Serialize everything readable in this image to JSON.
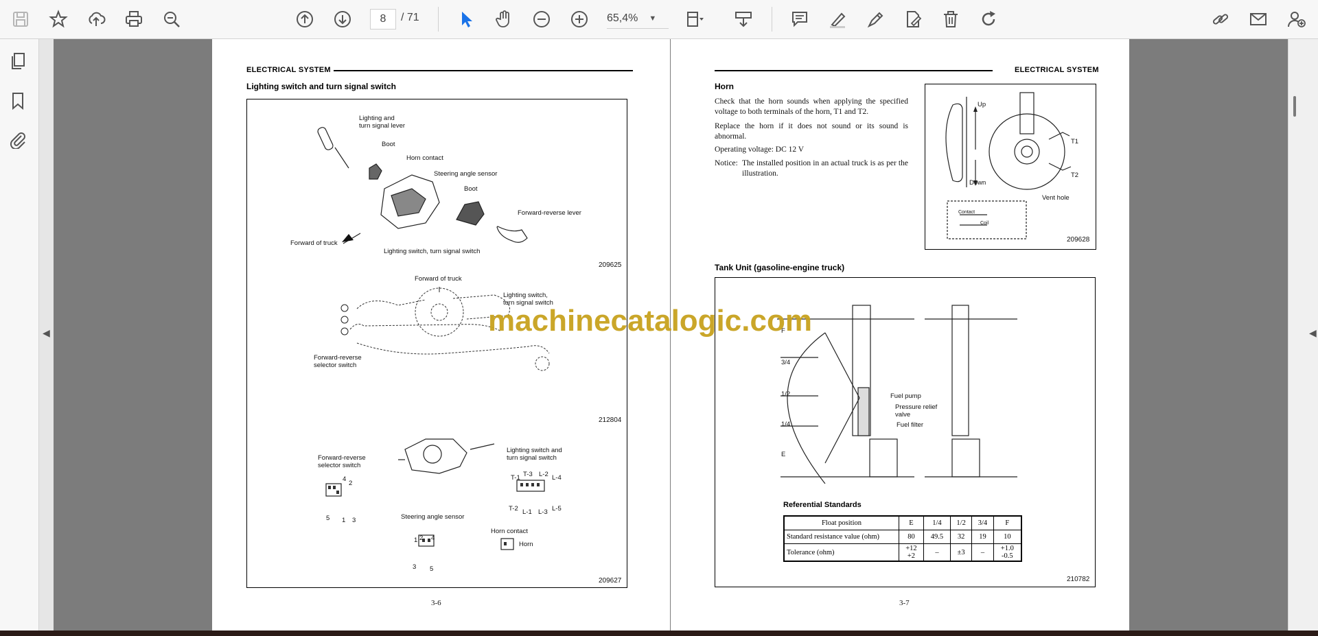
{
  "toolbar": {
    "current_page": "8",
    "total_pages": "/ 71",
    "zoom": "65,4%"
  },
  "left_page": {
    "header": "ELECTRICAL SYSTEM",
    "section_title": "Lighting switch and turn signal switch",
    "fig1": {
      "labels": [
        "Lighting and\nturn signal lever",
        "Boot",
        "Horn contact",
        "Steering angle sensor",
        "Boot",
        "Forward-reverse lever",
        "Forward of truck",
        "Lighting switch, turn signal switch"
      ],
      "code": "209625"
    },
    "fig2": {
      "labels": [
        "Forward of truck",
        "Lighting switch,\nturn signal switch",
        "Forward-reverse\nselector switch"
      ],
      "code": "212804"
    },
    "fig3": {
      "labels": [
        "Forward-reverse\nselector switch",
        "Lighting switch and\nturn signal switch",
        "Steering angle sensor",
        "Horn contact",
        "Horn"
      ],
      "pins": [
        "T-1",
        "T-3",
        "L-2",
        "L-4",
        "T-2",
        "L-1",
        "L-3",
        "L-5",
        "4",
        "2",
        "5",
        "1",
        "3",
        "1",
        "2",
        "4",
        "3",
        "5"
      ],
      "code": "209627"
    },
    "page_number": "3-6"
  },
  "right_page": {
    "header": "ELECTRICAL SYSTEM",
    "horn_title": "Horn",
    "horn_text": [
      "Check that the horn sounds when applying the specified voltage to both terminals of the horn, T1 and T2.",
      "Replace the horn if it does not sound or its sound is abnormal.",
      "Operating voltage:  DC 12 V"
    ],
    "notice_label": "Notice:",
    "notice_text": "The installed position in an actual truck is as per the illustration.",
    "horn_fig": {
      "labels": [
        "Up",
        "Down",
        "T1",
        "T2",
        "Vent hole",
        "Contact",
        "Coil"
      ],
      "code": "209628"
    },
    "tank_title": "Tank Unit (gasoline-engine truck)",
    "tank_fig": {
      "scale": [
        "F",
        "3/4",
        "1/2",
        "1/4",
        "E"
      ],
      "labels": [
        "Fuel pump",
        "Pressure relief\nvalve",
        "Fuel filter"
      ],
      "code": "210782"
    },
    "ref_title": "Referential Standards",
    "table": {
      "headers": [
        "Float position",
        "E",
        "1/4",
        "1/2",
        "3/4",
        "F"
      ],
      "rows": [
        [
          "Standard resistance value (ohm)",
          "80",
          "49.5",
          "32",
          "19",
          "10"
        ],
        [
          "Tolerance (ohm)",
          "+12\n+2",
          "–",
          "±3",
          "–",
          "+1.0\n-0.5"
        ]
      ]
    },
    "page_number": "3-7"
  },
  "watermark": "machinecatalogic.com",
  "colors": {
    "watermark": "#c8a21e",
    "accent_blue": "#1a73e8",
    "viewer_bg": "#7c7c7c"
  }
}
